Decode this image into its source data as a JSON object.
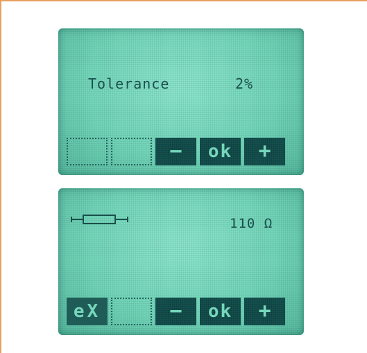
{
  "screen1": {
    "label": "Tolerance",
    "value": "2%",
    "softkeys": {
      "key1": "",
      "key2": "",
      "key3": "−",
      "key4": "ok",
      "key5": "+"
    }
  },
  "screen2": {
    "icon": "resistor-icon",
    "value": "110 Ω",
    "softkeys": {
      "key1": "eX",
      "key2": "",
      "key3": "−",
      "key4": "ok",
      "key5": "+"
    }
  },
  "colors": {
    "lcd_background": "#7ad9bd",
    "lcd_text": "#1b4f4d",
    "key_fill": "#14514f",
    "frame_border": "#e8a060"
  }
}
